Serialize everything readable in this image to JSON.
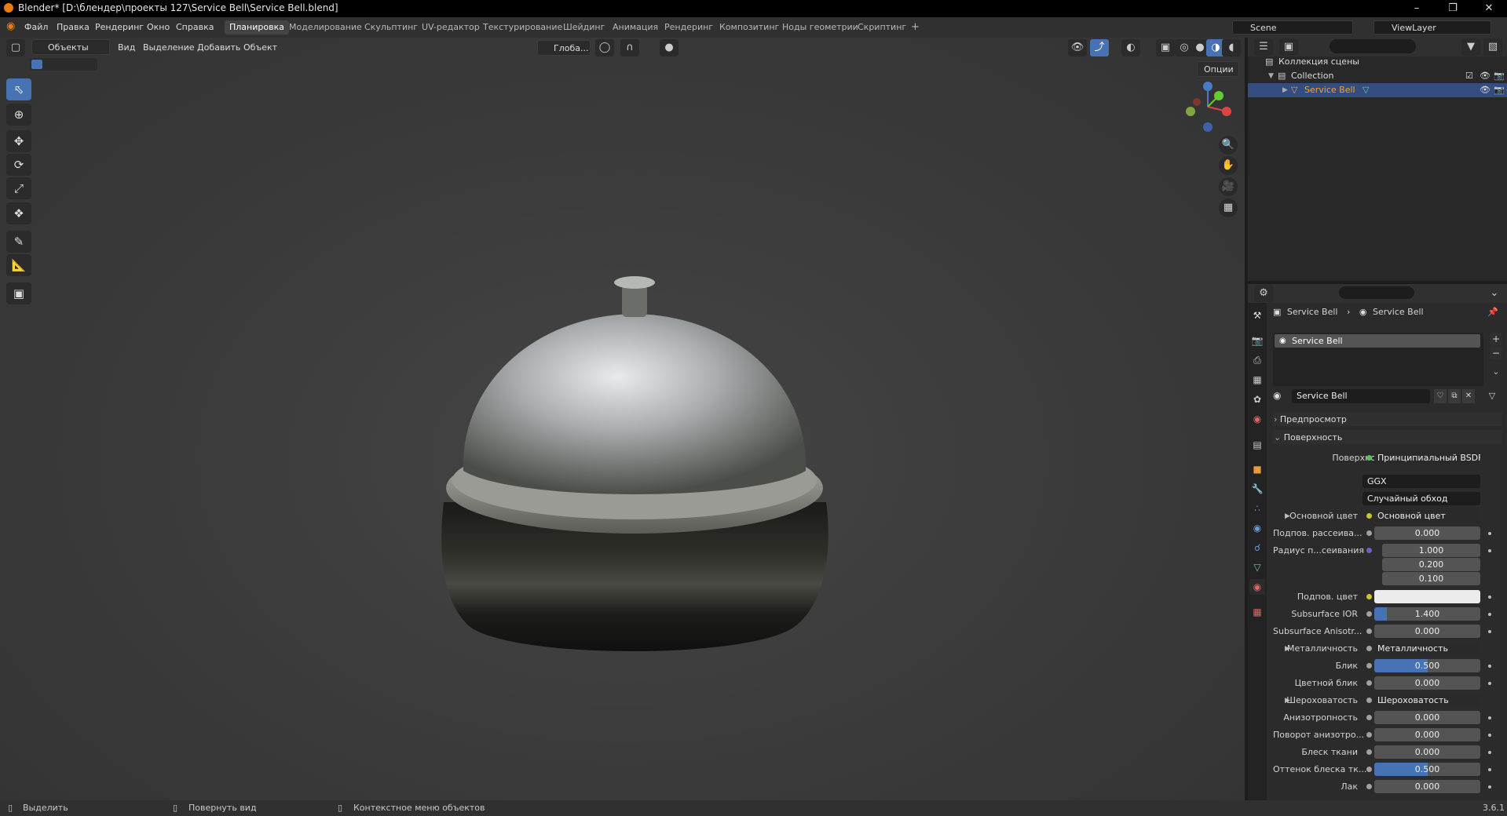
{
  "window": {
    "title": "Blender* [D:\\блендер\\проекты 127\\Service Bell\\Service Bell.blend]"
  },
  "menu": [
    "Файл",
    "Правка",
    "Рендеринг",
    "Окно",
    "Справка"
  ],
  "workspaces": [
    "Планировка",
    "Моделирование",
    "Скульптинг",
    "UV-редактор",
    "Текстурирование",
    "Шейдинг",
    "Анимация",
    "Рендеринг",
    "Композитинг",
    "Ноды геометрии",
    "Скриптинг"
  ],
  "active_workspace": "Планировка",
  "scene": "Scene",
  "view_layer": "ViewLayer",
  "viewport": {
    "mode": "Объекты",
    "menus": [
      "Вид",
      "Выделение",
      "Добавить",
      "Объект"
    ],
    "orientation": "Глоба...",
    "options": "Опции"
  },
  "outliner": {
    "scene_collection": "Коллекция сцены",
    "collection": "Collection",
    "object": "Service Bell"
  },
  "properties": {
    "breadcrumb_object": "Service Bell",
    "breadcrumb_material": "Service Bell",
    "slot": "Service Bell",
    "material_name": "Service Bell",
    "sections": {
      "preview": "Предпросмотр",
      "surface": "Поверхность"
    },
    "surface_label": "Поверхность",
    "surface_value": "Принципиальный BSDF",
    "distribution": "GGX",
    "subsurface_method": "Случайный обход",
    "rows": [
      {
        "label": "Основной цвет",
        "value": "Основной цвет",
        "type": "link"
      },
      {
        "label": "Подпов. рассеива...",
        "value": "0.000",
        "type": "num",
        "fill": 0
      },
      {
        "label": "Радиус п...сеивания",
        "value": "1.000",
        "type": "num",
        "fill": 0
      },
      {
        "label": "",
        "value": "0.200",
        "type": "num",
        "fill": 0
      },
      {
        "label": "",
        "value": "0.100",
        "type": "num",
        "fill": 0
      },
      {
        "label": "Подпов. цвет",
        "value": "",
        "type": "color"
      },
      {
        "label": "Subsurface IOR",
        "value": "1.400",
        "type": "num",
        "fill": 0.12
      },
      {
        "label": "Subsurface Anisotr...",
        "value": "0.000",
        "type": "num",
        "fill": 0
      },
      {
        "label": "Металличность",
        "value": "Металличность",
        "type": "link"
      },
      {
        "label": "Блик",
        "value": "0.500",
        "type": "num",
        "fill": 0.5
      },
      {
        "label": "Цветной блик",
        "value": "0.000",
        "type": "num",
        "fill": 0
      },
      {
        "label": "Шероховатость",
        "value": "Шероховатость",
        "type": "link"
      },
      {
        "label": "Анизотропность",
        "value": "0.000",
        "type": "num",
        "fill": 0
      },
      {
        "label": "Поворот анизотро...",
        "value": "0.000",
        "type": "num",
        "fill": 0
      },
      {
        "label": "Блеск ткани",
        "value": "0.000",
        "type": "num",
        "fill": 0
      },
      {
        "label": "Оттенок блеска тк...",
        "value": "0.500",
        "type": "num",
        "fill": 0.5
      },
      {
        "label": "Лак",
        "value": "0.000",
        "type": "num",
        "fill": 0
      }
    ]
  },
  "status": {
    "select": "Выделить",
    "rotate": "Повернуть вид",
    "context": "Контекстное меню объектов",
    "version": "3.6.1"
  },
  "colors": {
    "accent": "#4772b3",
    "header": "#303030",
    "bg": "#1d1d1d",
    "viewport": "#3d3d3d",
    "selected_row": "#334d80"
  }
}
